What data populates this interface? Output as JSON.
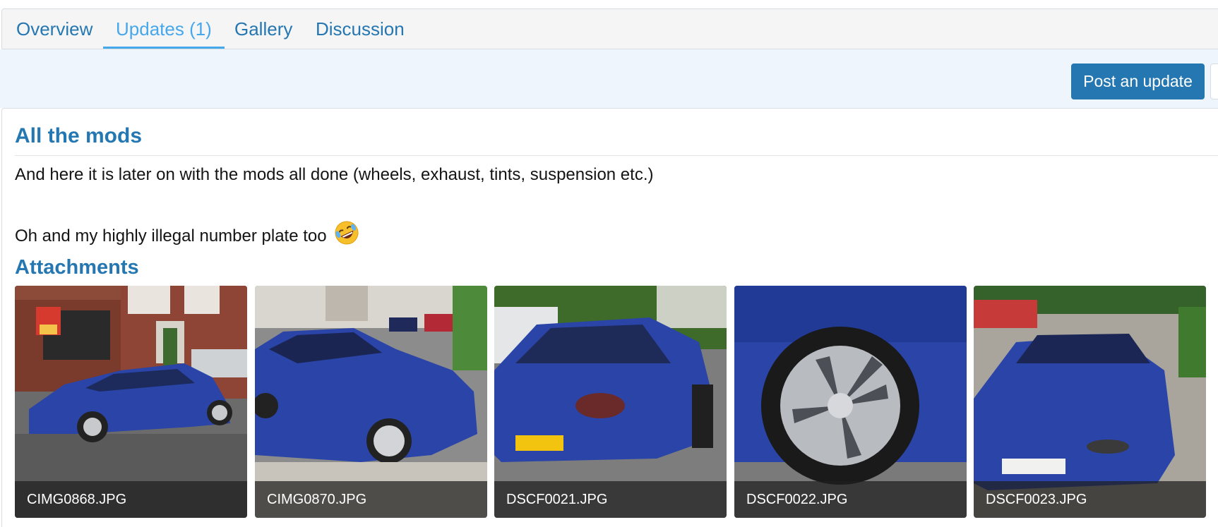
{
  "tabs": [
    {
      "label": "Overview",
      "active": false
    },
    {
      "label": "Updates (1)",
      "active": true
    },
    {
      "label": "Gallery",
      "active": false
    },
    {
      "label": "Discussion",
      "active": false
    }
  ],
  "actions": {
    "post_update_label": "Post an update"
  },
  "update": {
    "title": "All the mods",
    "line1": "And here it is later on with the mods all done (wheels, exhaust, tints, suspension etc.)",
    "line2": "Oh and my highly illegal number plate too",
    "emoji_icon": "rolling-on-floor-laughing-emoji"
  },
  "attachments": {
    "heading": "Attachments",
    "items": [
      {
        "filename": "CIMG0868.JPG"
      },
      {
        "filename": "CIMG0870.JPG"
      },
      {
        "filename": "DSCF0021.JPG"
      },
      {
        "filename": "DSCF0022.JPG"
      },
      {
        "filename": "DSCF0023.JPG"
      }
    ]
  },
  "colors": {
    "accent": "#2577b1",
    "active_tab": "#47a7eb",
    "actionbar_bg": "#eef5fd",
    "car_blue": "#2a44a8"
  }
}
